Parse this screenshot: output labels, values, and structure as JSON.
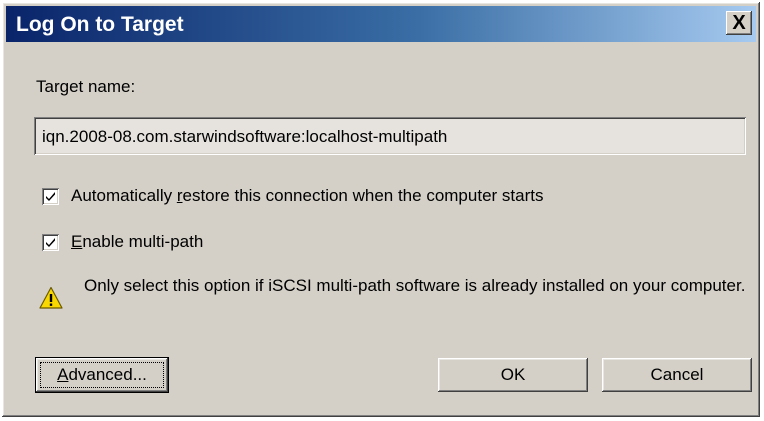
{
  "window": {
    "title": "Log On to Target",
    "close_glyph": "X"
  },
  "target": {
    "label": "Target name:",
    "value": "iqn.2008-08.com.starwindsoftware:localhost-multipath"
  },
  "options": {
    "auto_restore": {
      "label_pre": "Automatically ",
      "label_accel": "r",
      "label_post": "estore this connection when the computer starts",
      "checked": true
    },
    "multipath": {
      "label_accel": "E",
      "label_post": "nable multi-path",
      "checked": true
    }
  },
  "warning": {
    "icon": "warning-icon",
    "text": "Only select this option if iSCSI multi-path software is already installed on your computer."
  },
  "buttons": {
    "advanced_accel": "A",
    "advanced_rest": "dvanced...",
    "ok": "OK",
    "cancel": "Cancel"
  },
  "colors": {
    "titlebar_start": "#0a246a",
    "titlebar_end": "#a6caf0",
    "face": "#d4d0c8",
    "warning_yellow": "#f8d800"
  }
}
